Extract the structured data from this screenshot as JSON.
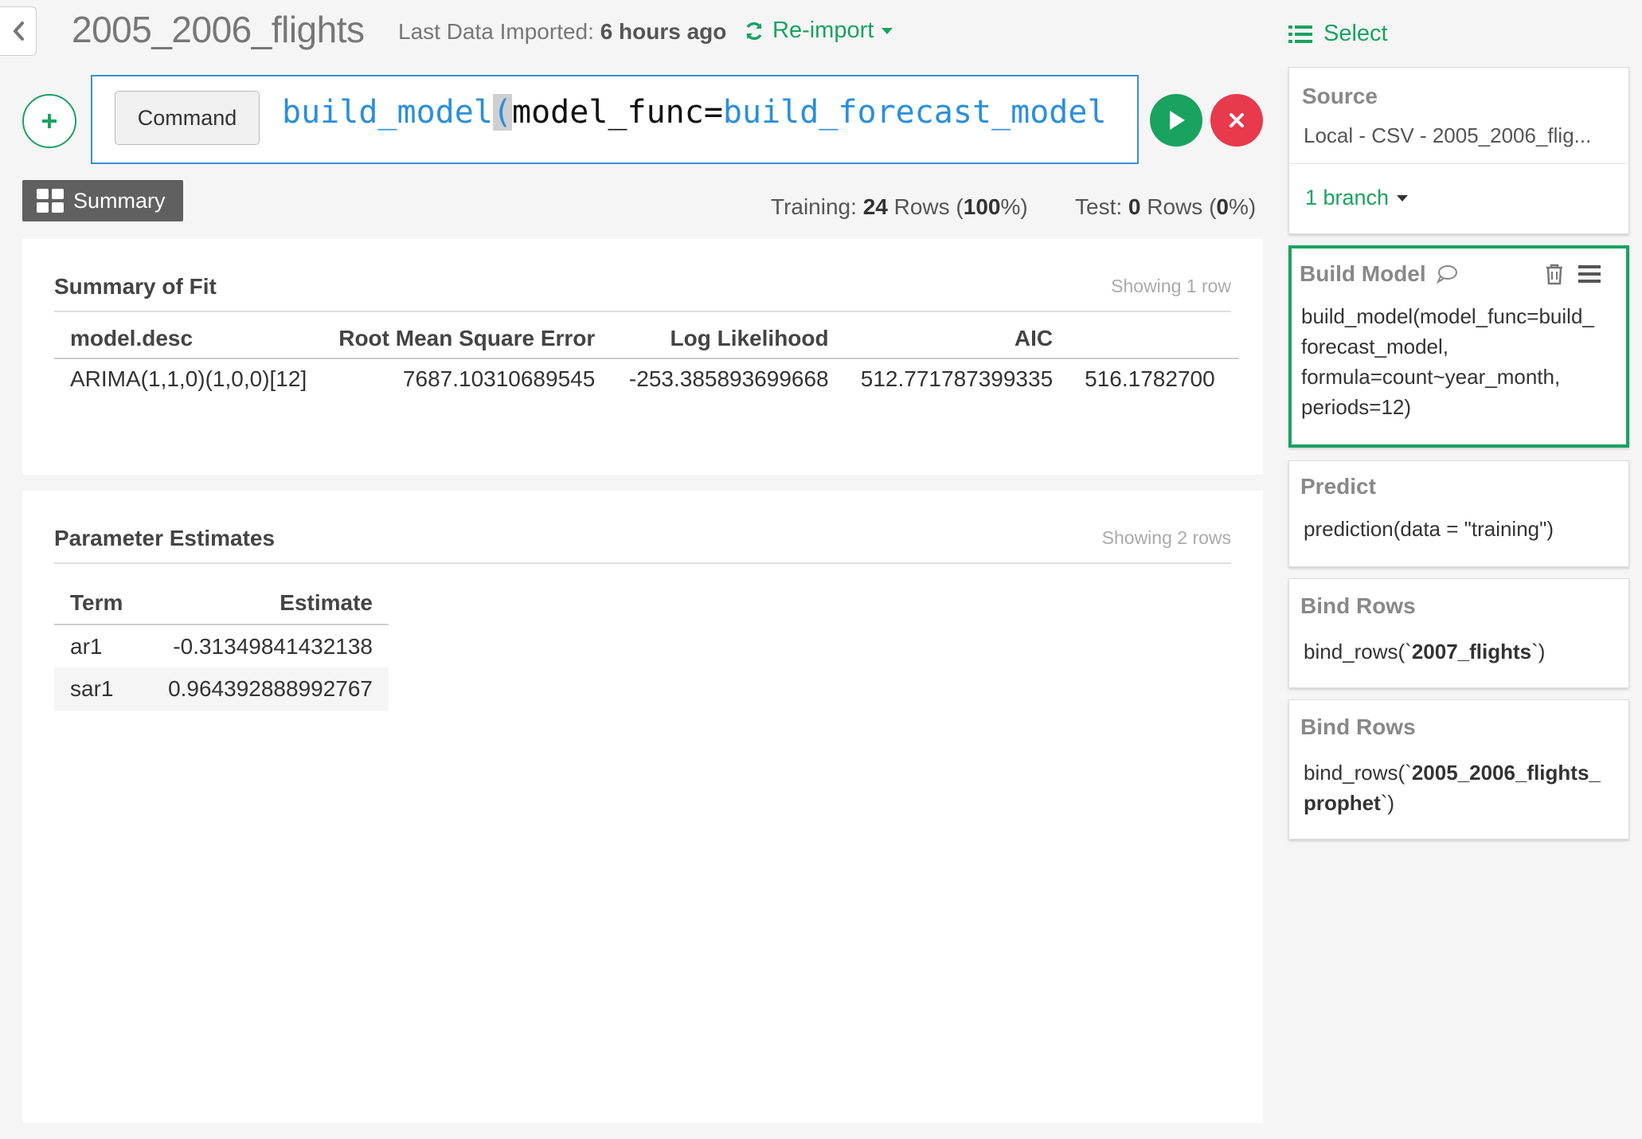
{
  "header": {
    "project_title": "2005_2006_flights",
    "last_imported_label": "Last Data Imported:",
    "last_imported_value": "6 hours ago",
    "reimport_label": "Re-import",
    "select_label": "Select"
  },
  "command": {
    "button_label": "Command",
    "fn_name": "build_model",
    "open_paren": "(",
    "arg_name": "model_func=",
    "arg_value": "build_forecast_model"
  },
  "summary": {
    "tab_label": "Summary",
    "training_label": "Training:",
    "training_rows": "24",
    "training_rows_word": "Rows (",
    "training_pct": "100",
    "training_pct_suffix": "%)",
    "test_label": "Test:",
    "test_rows": "0",
    "test_rows_word": "Rows (",
    "test_pct": "0",
    "test_pct_suffix": "%)"
  },
  "fit": {
    "title": "Summary of Fit",
    "count": "Showing 1 row",
    "columns": [
      "model.desc",
      "Root Mean Square Error",
      "Log Likelihood",
      "AIC",
      ""
    ],
    "rows": [
      [
        "ARIMA(1,1,0)(1,0,0)[12]",
        "7687.10310689545",
        "-253.385893699668",
        "512.771787399335",
        "516.1782700"
      ]
    ]
  },
  "params": {
    "title": "Parameter Estimates",
    "count": "Showing 2 rows",
    "columns": [
      "Term",
      "Estimate"
    ],
    "rows": [
      [
        "ar1",
        "-0.31349841432138"
      ],
      [
        "sar1",
        "0.964392888992767"
      ]
    ]
  },
  "sidebar": {
    "source": {
      "title": "Source",
      "value": "Local - CSV - 2005_2006_flig...",
      "branch_label": "1 branch"
    },
    "steps": [
      {
        "title": "Build Model",
        "body_lines": [
          "build_model(model_func=build_",
          "forecast_model,",
          "formula=count~year_month,",
          "periods=12)"
        ]
      },
      {
        "title": "Predict",
        "body_lines": [
          "prediction(data = \"training\")"
        ]
      },
      {
        "title": "Bind Rows",
        "body_prefix": "bind_rows(`",
        "body_bold": "2007_flights",
        "body_suffix": "`)"
      },
      {
        "title": "Bind Rows",
        "body_prefix": "bind_rows(`",
        "body_bold_1": "2005_2006_flights_",
        "body_bold_2": "prophet",
        "body_suffix": "`)"
      }
    ]
  },
  "colors": {
    "accent_green": "#1aa260",
    "cancel_red": "#e8394d",
    "command_blue": "#2a8fdc"
  },
  "icons": [
    "chevron-left-icon",
    "refresh-icon",
    "list-icon",
    "plus-icon",
    "play-icon",
    "close-icon",
    "grid-icon",
    "comment-icon",
    "trash-icon",
    "menu-icon",
    "caret-down-icon"
  ]
}
